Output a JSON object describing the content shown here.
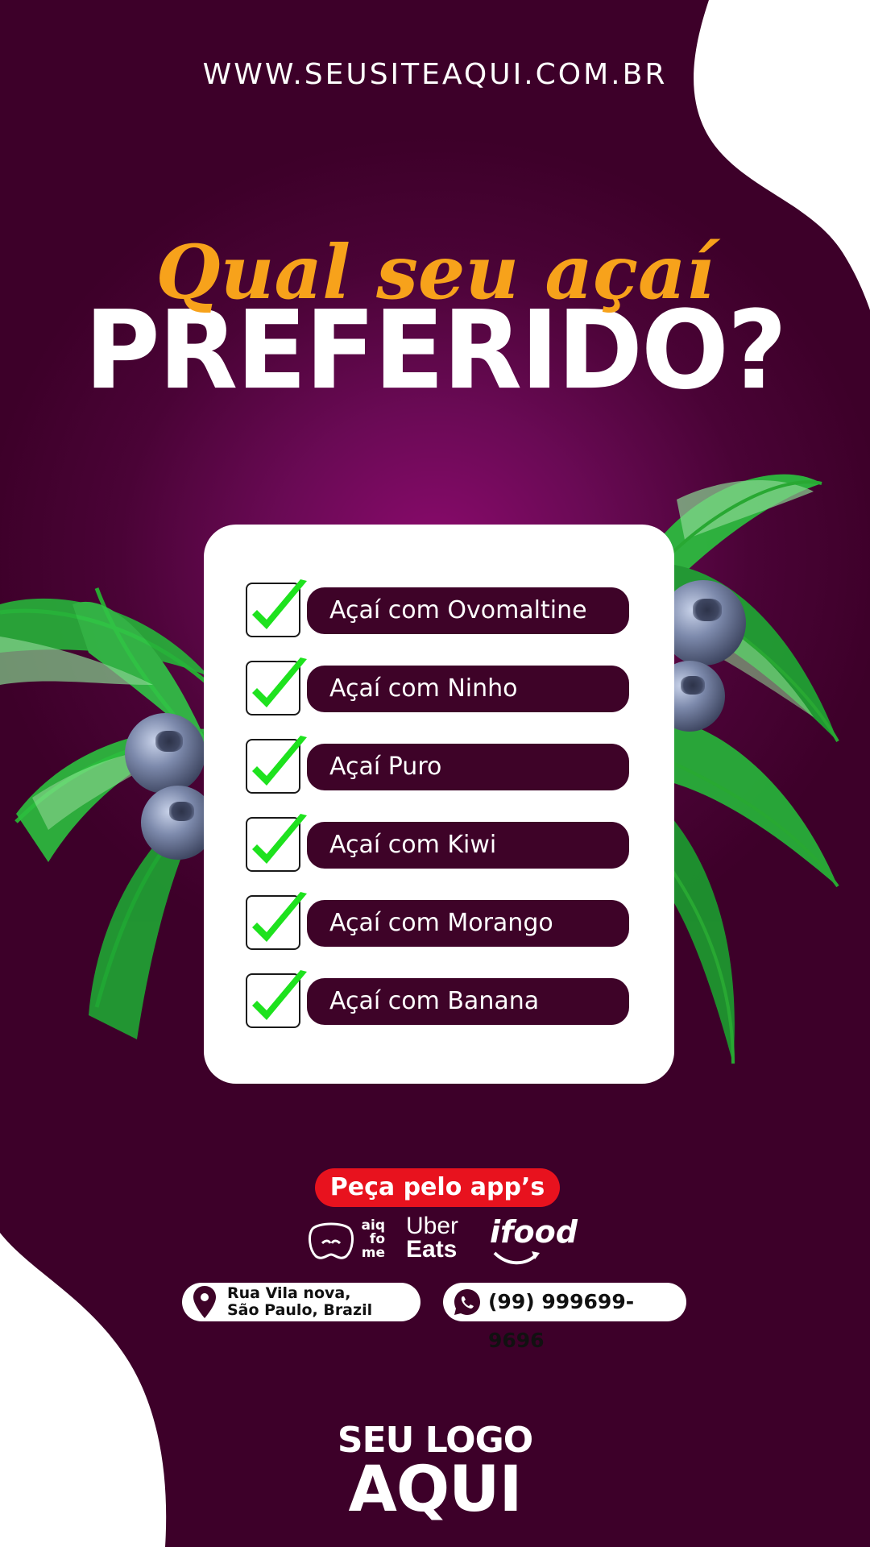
{
  "website": "WWW.SEUSITEAQUI.COM.BR",
  "headline": {
    "script": "Qual seu açaí",
    "main": "PREFERIDO?"
  },
  "options": [
    "Açaí com Ovomaltine",
    "Açaí com Ninho",
    "Açaí Puro",
    "Açaí com Kiwi",
    "Açaí com Morango",
    "Açaí com Banana"
  ],
  "order": {
    "label": "Peça pelo app’s",
    "apps": {
      "aiqfome": [
        "aiq",
        "fo",
        "me"
      ],
      "ubereats": [
        "Uber",
        "Eats"
      ],
      "ifood": "ifood"
    }
  },
  "contact": {
    "address_line1": "Rua Vila nova,",
    "address_line2": "São Paulo, Brazil",
    "phone": "(99) 999699-9696"
  },
  "logo": {
    "line1": "SEU LOGO",
    "line2": "AQUI"
  },
  "colors": {
    "background": "#3d0029",
    "accent_orange": "#f7a21b",
    "pill": "#3e0328",
    "order_red": "#e8121e",
    "check_green": "#1ee21e"
  },
  "icons": [
    "check-icon",
    "map-pin-icon",
    "whatsapp-icon"
  ]
}
